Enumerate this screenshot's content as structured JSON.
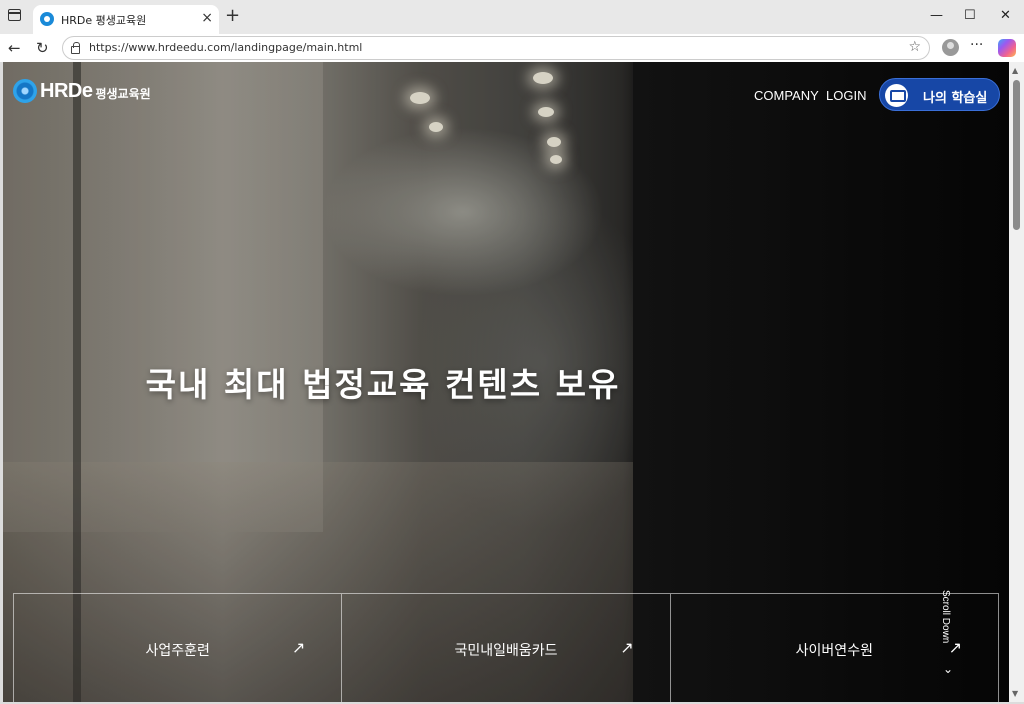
{
  "browser": {
    "tab_title": "HRDe 평생교육원",
    "tab_close": "×",
    "new_tab": "+",
    "url": "https://www.hrdeedu.com/landingpage/main.html",
    "minimize": "—",
    "maximize": "☐",
    "close": "✕",
    "back": "←",
    "reload": "↻",
    "star": "☆",
    "more": "···"
  },
  "site": {
    "logo_text": "HRDe",
    "logo_sub": "평생교육원",
    "nav": {
      "company": "COMPANY",
      "login": "LOGIN"
    },
    "my_learning": "나의 학습실",
    "hero_title": "국내 최대 법정교육 컨텐츠 보유",
    "quick_links": [
      {
        "label": "사업주훈련",
        "arrow": "↗"
      },
      {
        "label": "국민내일배움카드",
        "arrow": "↗"
      },
      {
        "label": "사이버연수원",
        "arrow": "↗"
      }
    ],
    "scroll_down": "Scroll Down",
    "scroll_chevron": "⌄"
  }
}
